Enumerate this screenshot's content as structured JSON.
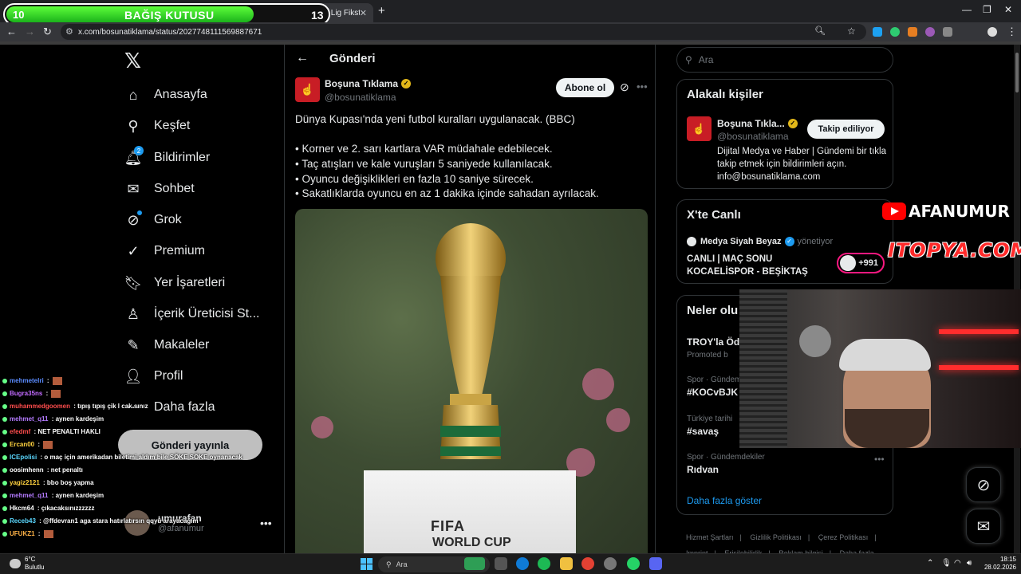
{
  "donation": {
    "left_number": "10",
    "title": "BAĞIŞ KUTUSU",
    "right_number": "13"
  },
  "browser": {
    "tab_title": "Trendyol Süper Lig Fikstürü ve P",
    "url": "x.com/bosunatiklama/status/2027748111569887671"
  },
  "nav": {
    "items": [
      {
        "label": "Anasayfa",
        "icon": "home-icon"
      },
      {
        "label": "Keşfet",
        "icon": "search-icon"
      },
      {
        "label": "Bildirimler",
        "icon": "bell-icon",
        "badge": "2"
      },
      {
        "label": "Sohbet",
        "icon": "mail-icon"
      },
      {
        "label": "Grok",
        "icon": "grok-icon"
      },
      {
        "label": "Premium",
        "icon": "verified-icon"
      },
      {
        "label": "Yer İşaretleri",
        "icon": "bookmark-icon"
      },
      {
        "label": "İçerik Üreticisi St...",
        "icon": "creator-icon"
      },
      {
        "label": "Makaleler",
        "icon": "article-icon"
      },
      {
        "label": "Profil",
        "icon": "person-icon"
      },
      {
        "label": "Daha fazla",
        "icon": "more-circle-icon"
      }
    ],
    "post_button": "Gönderi yayınla",
    "account": {
      "name": "umurafan",
      "handle": "@afanumur"
    }
  },
  "post": {
    "header_title": "Gönderi",
    "author_name": "Boşuna Tıklama",
    "author_handle": "@bosunatiklama",
    "subscribe_label": "Abone ol",
    "text_lines": [
      "Dünya Kupası'nda yeni futbol kuralları uygulanacak. (BBC)",
      "• Korner ve 2. sarı kartlara VAR müdahale edebilecek.",
      "• Taç atışları ve kale vuruşları 5 saniyede kullanılacak.",
      "• Oyuncu değişiklikleri en fazla 10 saniye sürecek.",
      "• Sakatlıklarda oyuncu en az 1 dakika içinde sahadan ayrılacak."
    ],
    "image_text_1": "FIFA",
    "image_text_2": "WORLD CUP"
  },
  "sidebar": {
    "search_placeholder": "Ara",
    "related": {
      "title": "Alakalı kişiler",
      "name": "Boşuna Tıkla...",
      "handle": "@bosunatiklama",
      "follow_label": "Takip ediliyor",
      "bio": "Dijital Medya ve Haber | Gündemi bir tıkla takip etmek için bildirimleri açın. info@bosunatiklama.com"
    },
    "live": {
      "title": "X'te Canlı",
      "host": "Medya Siyah Beyaz",
      "role": "yönetiyor",
      "stream_title_1": "CANLI | MAÇ SONU",
      "stream_title_2": "KOCAELİSPOR - BEŞİKTAŞ",
      "listeners": "+991"
    },
    "trends": {
      "title": "Neler olu",
      "items": [
        {
          "context": "",
          "topic": "TROY'la Öd",
          "promo": "Promoted b"
        },
        {
          "context": "Spor · Gündem",
          "topic": "#KOCvBJK"
        },
        {
          "context": "Türkiye tarihi",
          "topic": "#savaş"
        },
        {
          "context": "Spor · Gündemdekiler",
          "topic": "Rıdvan"
        }
      ],
      "show_more": "Daha fazla göster"
    },
    "footer": [
      "Hizmet Şartları",
      "|",
      "Gizlilik Politikası",
      "|",
      "Çerez Politikası",
      "|",
      "Imprint",
      "|",
      "Erişilebilirlik",
      "|",
      "Reklam bilgisi",
      "|",
      "Daha fazla ..."
    ]
  },
  "overlay": {
    "brand_1": "AFANUMUR",
    "brand_2": "ITOPYA.COM",
    "chat": [
      {
        "user": "mehmetelri",
        "color": "#5b8cff",
        "msg": ""
      },
      {
        "user": "Bugra35ns",
        "color": "#c26bff",
        "msg": ""
      },
      {
        "user": "muhammedgoomen",
        "color": "#ff4d4d",
        "msg": "tıpış tıpış çik l cak sınız"
      },
      {
        "user": "mehmet_q11",
        "color": "#b47bff",
        "msg": "aynen kardeşim"
      },
      {
        "user": "efedmf",
        "color": "#ff4d4d",
        "msg": "NET PENALTI HAKLI"
      },
      {
        "user": "Ercan00",
        "color": "#ffd23f",
        "msg": ""
      },
      {
        "user": "ICEpolisi",
        "color": "#5bd8ff",
        "msg": "o maç için amerikadan biletimi aldım bile SÖKE SÖKE oynanacak"
      },
      {
        "user": "oosimhenn",
        "color": "#ffffff",
        "msg": "net penaltı"
      },
      {
        "user": "yagiz2121",
        "color": "#ffd23f",
        "msg": "bbo boş yapma"
      },
      {
        "user": "mehmet_q11",
        "color": "#b47bff",
        "msg": "aynen kardeşim"
      },
      {
        "user": "Hkcm64",
        "color": "#ffffff",
        "msg": "çıkacaksınızzzzzz"
      },
      {
        "user": "Receb43",
        "color": "#5bd8ff",
        "msg": "@ffdevran1 aga stara hatırlatırsın qqyü arayacağım"
      },
      {
        "user": "UFUKZ1",
        "color": "#ffb347",
        "msg": ""
      }
    ]
  },
  "taskbar": {
    "temp": "6°C",
    "weather": "Bulutlu",
    "search": "Ara",
    "time": "18:15",
    "date": "28.02.2026"
  }
}
